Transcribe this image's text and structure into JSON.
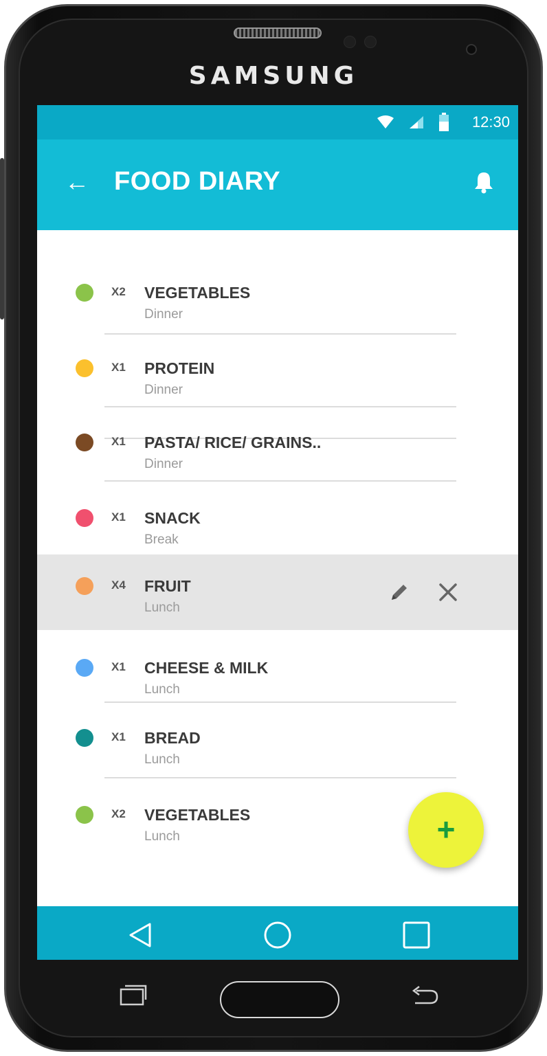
{
  "device": {
    "brand": "SAMSUNG"
  },
  "status_bar": {
    "time": "12:30",
    "icons": [
      "wifi-icon",
      "signal-icon",
      "battery-icon"
    ]
  },
  "app_bar": {
    "title": "FOOD DIARY",
    "back_icon": "arrow-left-icon",
    "notification_icon": "bell-icon"
  },
  "items": [
    {
      "qty": "X2",
      "name": "VEGETABLES",
      "meal": "Dinner",
      "color": "#8bc34a",
      "selected": false
    },
    {
      "qty": "X1",
      "name": "PROTEIN",
      "meal": "Dinner",
      "color": "#fbc02d",
      "selected": false
    },
    {
      "qty": "X1",
      "name": "PASTA/ RICE/ GRAINS..",
      "meal": "Dinner",
      "color": "#7b4a24",
      "selected": false
    },
    {
      "qty": "X1",
      "name": "SNACK",
      "meal": "Break",
      "color": "#f0506e",
      "selected": false
    },
    {
      "qty": "X4",
      "name": "FRUIT",
      "meal": "Lunch",
      "color": "#f5a05a",
      "selected": true
    },
    {
      "qty": "X1",
      "name": "CHEESE & MILK",
      "meal": "Lunch",
      "color": "#5aa9f5",
      "selected": false
    },
    {
      "qty": "X1",
      "name": "BREAD",
      "meal": "Lunch",
      "color": "#138f8f",
      "selected": false
    },
    {
      "qty": "X2",
      "name": "VEGETABLES",
      "meal": "Lunch",
      "color": "#8bc34a",
      "selected": false
    }
  ],
  "selected_actions": {
    "edit_icon": "pencil-icon",
    "delete_icon": "close-icon"
  },
  "fab": {
    "label": "+",
    "color": "#edf33a"
  },
  "nav_bar": {
    "icons": [
      "back-triangle-icon",
      "home-circle-icon",
      "recents-square-icon"
    ]
  },
  "colors": {
    "primary": "#13bcd6",
    "status_bar": "#0aa9c6",
    "selected_row": "#e5e5e5"
  }
}
